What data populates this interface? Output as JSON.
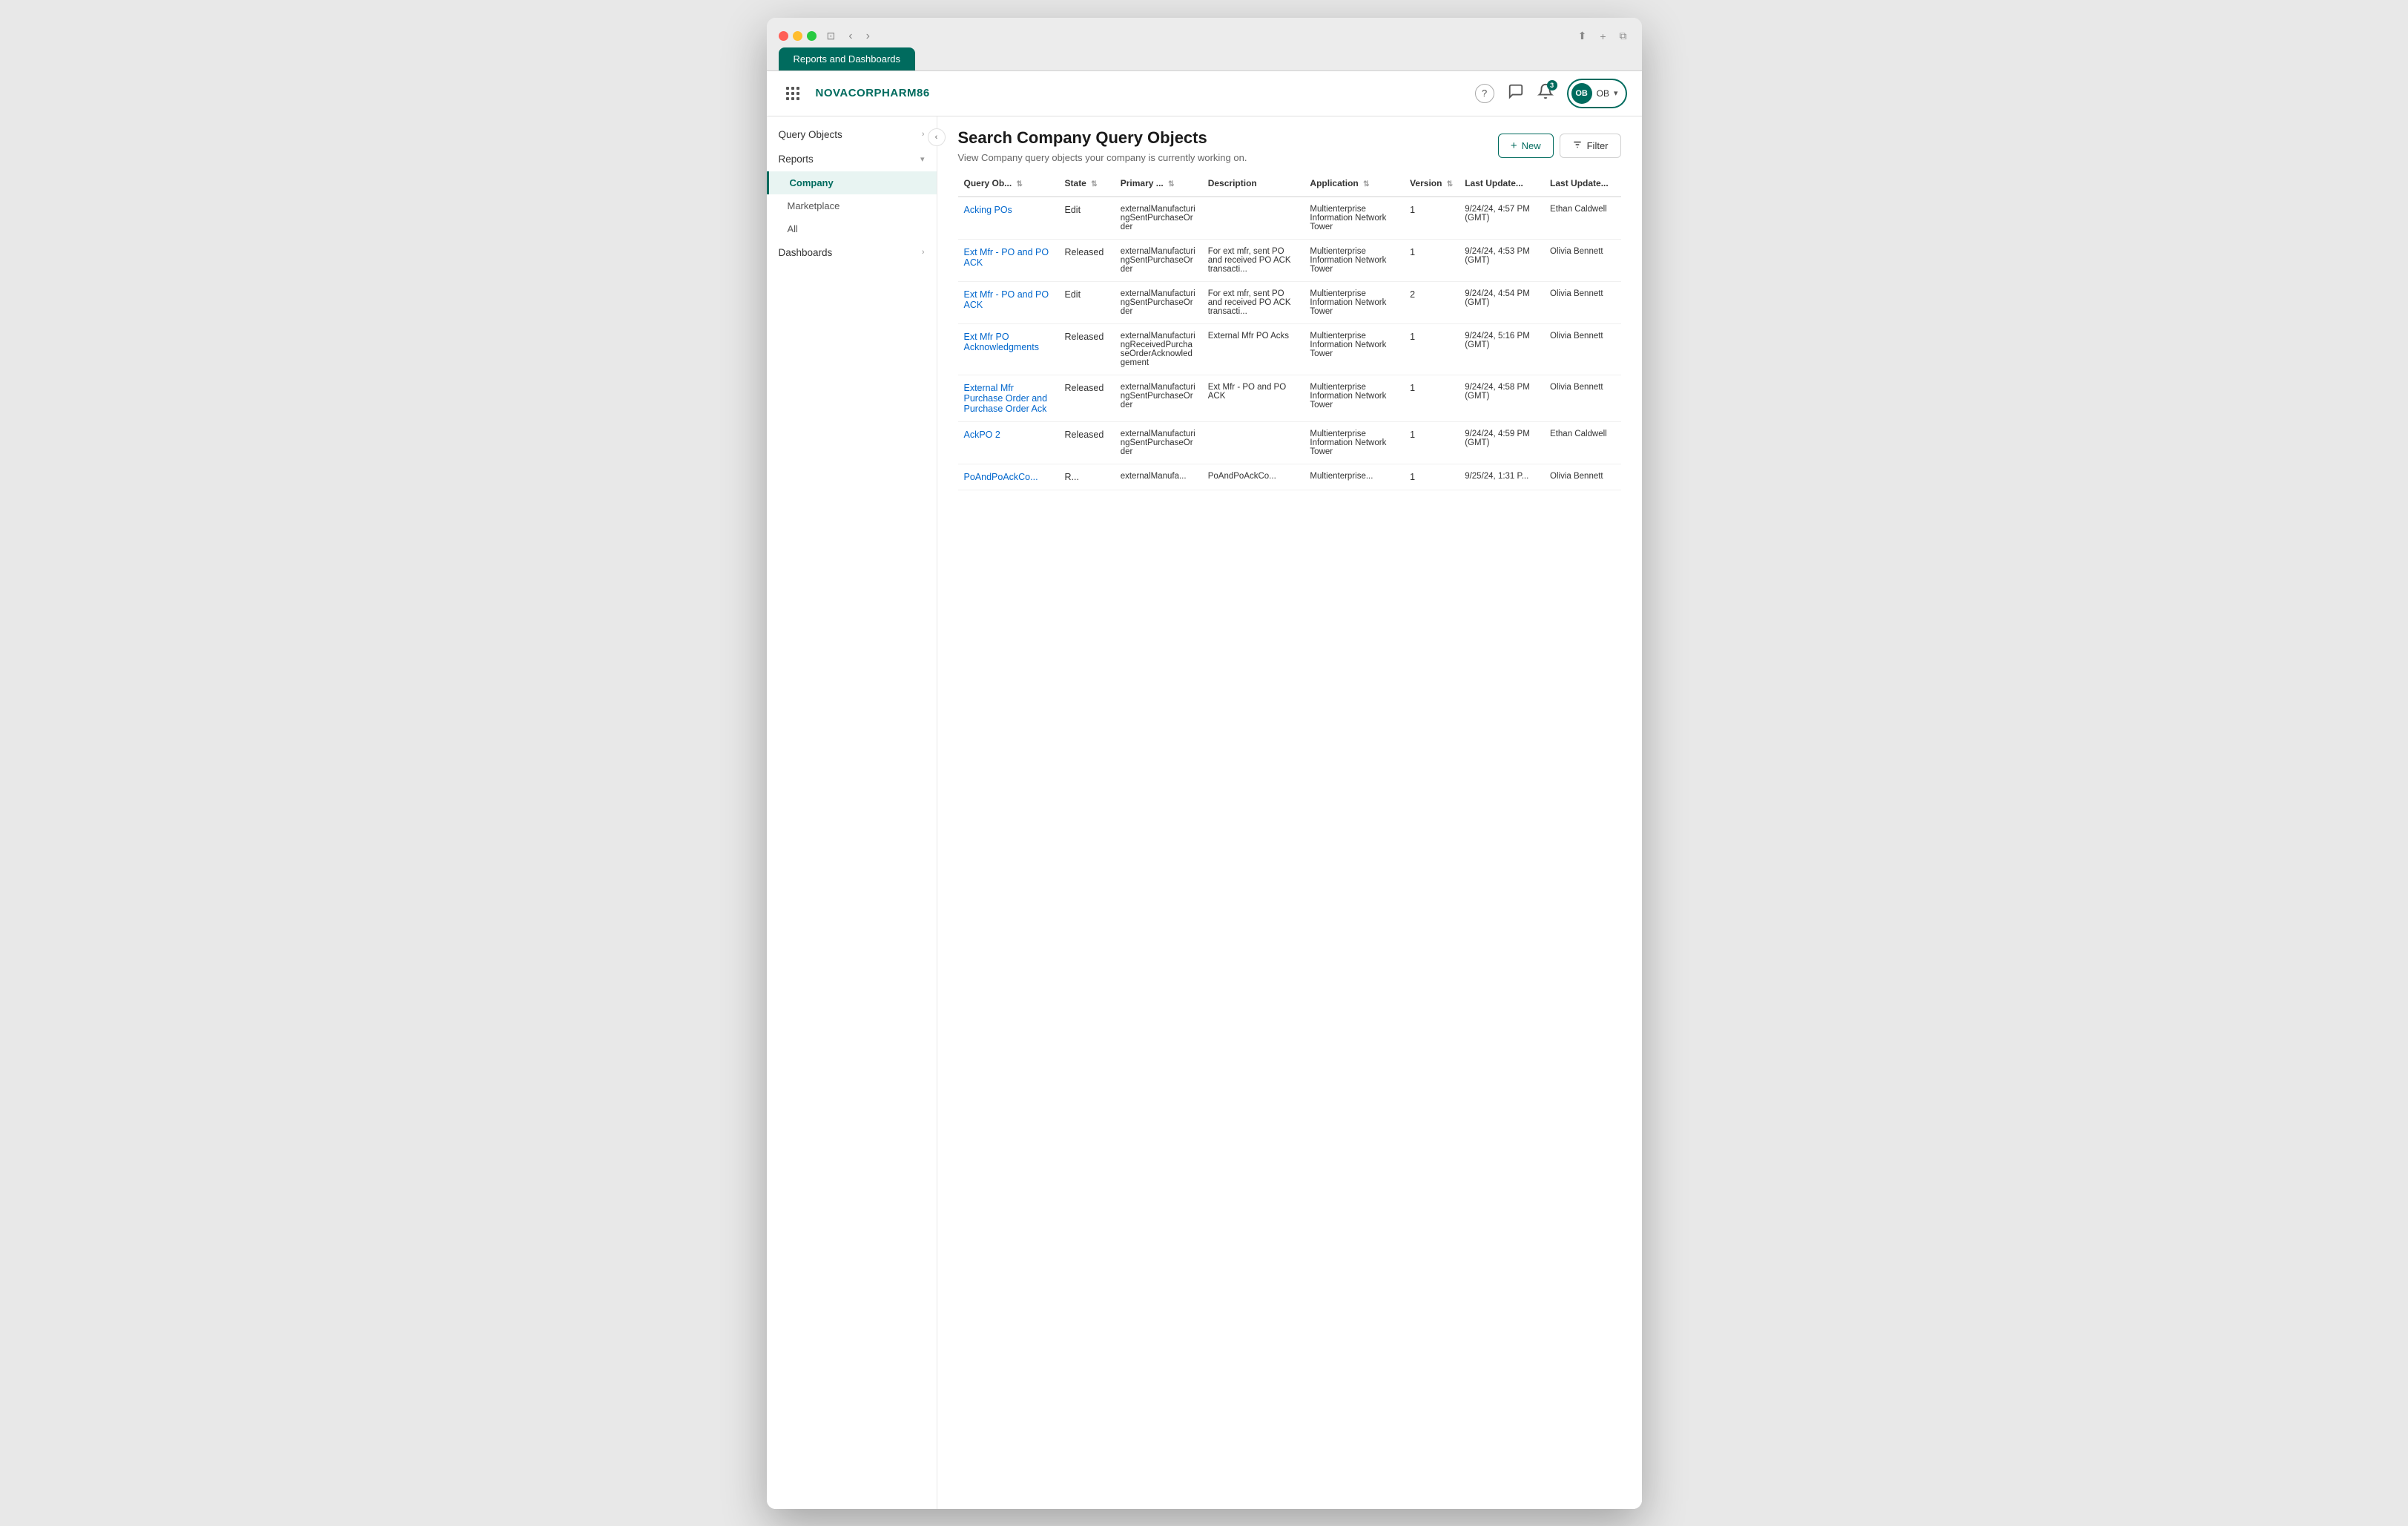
{
  "browser": {
    "tab_label": "Reports and Dashboards"
  },
  "header": {
    "brand": "NOVACORPHARM86",
    "notification_count": "3",
    "user_initials": "OB",
    "help_icon": "?",
    "chat_icon": "💬",
    "bell_icon": "🔔"
  },
  "sidebar": {
    "toggle_icon": "‹",
    "items": [
      {
        "label": "Query Objects",
        "has_arrow": true,
        "active": false
      },
      {
        "label": "Reports",
        "has_arrow": true,
        "expanded": true
      },
      {
        "label": "Company",
        "sub": true,
        "active": true
      },
      {
        "label": "Marketplace",
        "sub": true
      },
      {
        "label": "All",
        "sub": true
      },
      {
        "label": "Dashboards",
        "has_arrow": true
      }
    ]
  },
  "page": {
    "title": "Search Company Query Objects",
    "subtitle": "View Company query objects your company is currently working on.",
    "new_button": "New",
    "filter_button": "Filter"
  },
  "table": {
    "columns": [
      {
        "label": "Query Ob...",
        "sortable": true
      },
      {
        "label": "State",
        "sortable": true
      },
      {
        "label": "Primary ...",
        "sortable": true
      },
      {
        "label": "Description",
        "sortable": false
      },
      {
        "label": "Application",
        "sortable": true
      },
      {
        "label": "Version",
        "sortable": true
      },
      {
        "label": "Last Update...",
        "sortable": false
      },
      {
        "label": "Last Update...",
        "sortable": false
      }
    ],
    "rows": [
      {
        "query_obj": "Acking POs",
        "state": "Edit",
        "primary": "externalManufacturingSentPurchaseOrder",
        "description": "",
        "application": "Multienterprise Information Network Tower",
        "version": "1",
        "last_updated": "9/24/24, 4:57 PM (GMT)",
        "updated_by": "Ethan Caldwell"
      },
      {
        "query_obj": "Ext Mfr - PO and PO ACK",
        "state": "Released",
        "primary": "externalManufacturingSentPurchaseOrder",
        "description": "For ext mfr, sent PO and received PO ACK transacti...",
        "application": "Multienterprise Information Network Tower",
        "version": "1",
        "last_updated": "9/24/24, 4:53 PM (GMT)",
        "updated_by": "Olivia Bennett"
      },
      {
        "query_obj": "Ext Mfr - PO and PO ACK",
        "state": "Edit",
        "primary": "externalManufacturingSentPurchaseOrder",
        "description": "For ext mfr, sent PO and received PO ACK transacti...",
        "application": "Multienterprise Information Network Tower",
        "version": "2",
        "last_updated": "9/24/24, 4:54 PM (GMT)",
        "updated_by": "Olivia Bennett"
      },
      {
        "query_obj": "Ext Mfr PO Acknowledgments",
        "state": "Released",
        "primary": "externalManufacturingReceivedPurchaseOrderAcknowledgement",
        "description": "External Mfr PO Acks",
        "application": "Multienterprise Information Network Tower",
        "version": "1",
        "last_updated": "9/24/24, 5:16 PM (GMT)",
        "updated_by": "Olivia Bennett"
      },
      {
        "query_obj": "External Mfr Purchase Order and Purchase Order Ack",
        "state": "Released",
        "primary": "externalManufacturingSentPurchaseOrder",
        "description": "Ext Mfr - PO and PO ACK",
        "application": "Multienterprise Information Network Tower",
        "version": "1",
        "last_updated": "9/24/24, 4:58 PM (GMT)",
        "updated_by": "Olivia Bennett"
      },
      {
        "query_obj": "AckPO 2",
        "state": "Released",
        "primary": "externalManufacturingSentPurchaseOrder",
        "description": "",
        "application": "Multienterprise Information Network Tower",
        "version": "1",
        "last_updated": "9/24/24, 4:59 PM (GMT)",
        "updated_by": "Ethan Caldwell"
      },
      {
        "query_obj": "PoAndPoAckCo...",
        "state": "R...",
        "primary": "externalManufa...",
        "description": "PoAndPoAckCo...",
        "application": "Multienterprise...",
        "version": "1",
        "last_updated": "9/25/24, 1:31 P...",
        "updated_by": "Olivia Bennett"
      }
    ]
  }
}
